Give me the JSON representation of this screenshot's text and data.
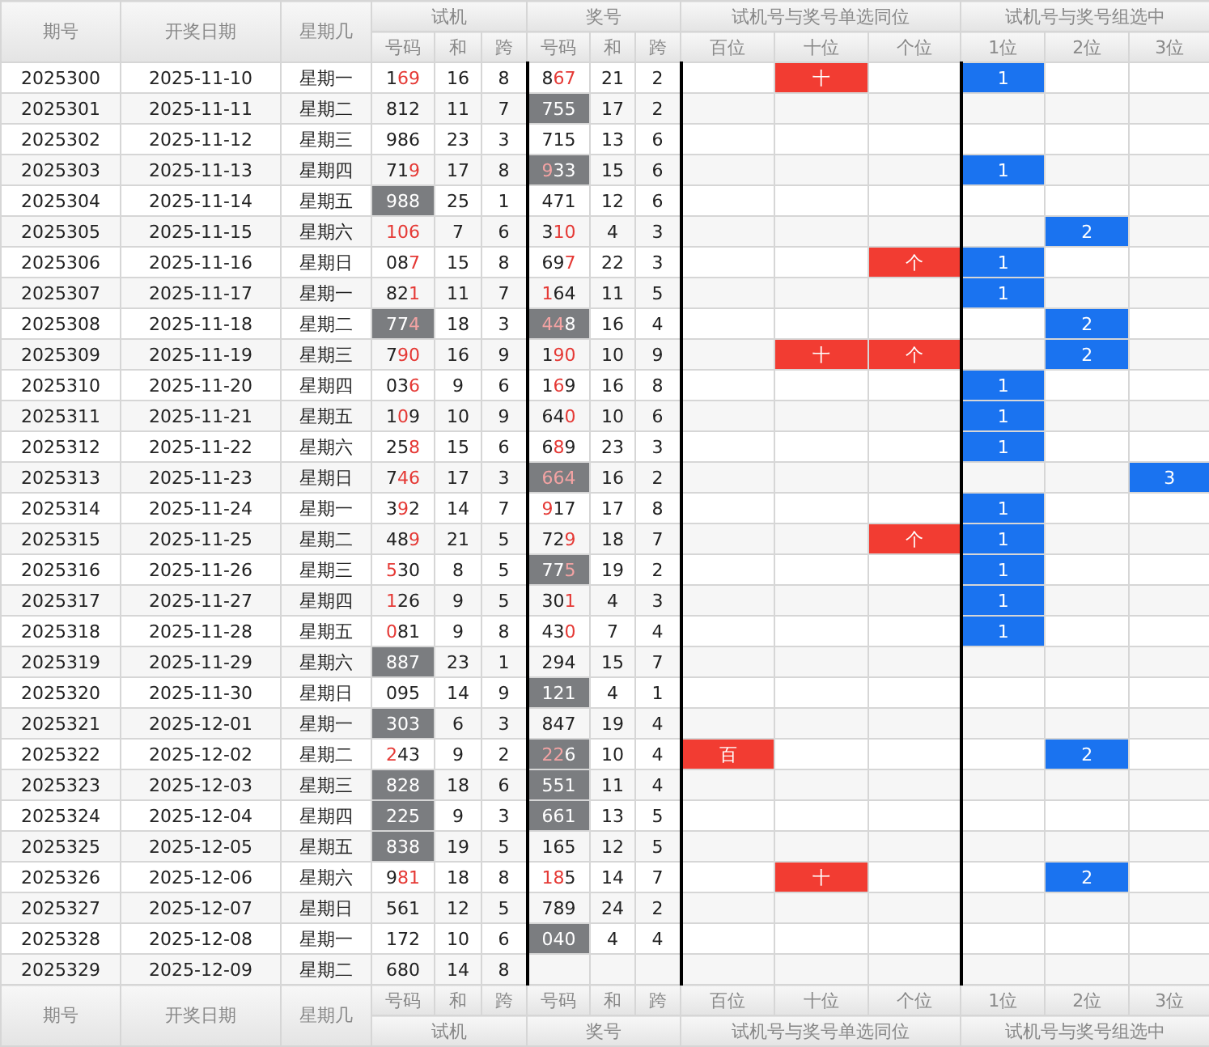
{
  "header": {
    "fixed": [
      "期号",
      "开奖日期",
      "星期几"
    ],
    "groups": [
      {
        "label": "试机",
        "subcolumns": [
          "号码",
          "和",
          "跨"
        ]
      },
      {
        "label": "奖号",
        "subcolumns": [
          "号码",
          "和",
          "跨"
        ]
      },
      {
        "label": "试机号与奖号单选同位",
        "subcolumns": [
          "百位",
          "十位",
          "个位"
        ]
      },
      {
        "label": "试机号与奖号组选中",
        "subcolumns": [
          "1位",
          "2位",
          "3位"
        ]
      }
    ]
  },
  "rows": [
    {
      "issue": "2025300",
      "date": "2025-11-10",
      "weekday": "星期一",
      "test": {
        "number": "169",
        "match": [
          false,
          true,
          true
        ],
        "pair": false,
        "sum": "16",
        "span": "8"
      },
      "draw": {
        "number": "867",
        "match": [
          false,
          true,
          true
        ],
        "pair": false,
        "sum": "21",
        "span": "2"
      },
      "single": {
        "tens": "十"
      },
      "group": {
        "pos1": "1"
      }
    },
    {
      "issue": "2025301",
      "date": "2025-11-11",
      "weekday": "星期二",
      "test": {
        "number": "812",
        "match": [
          false,
          false,
          false
        ],
        "pair": false,
        "sum": "11",
        "span": "7"
      },
      "draw": {
        "number": "755",
        "match": [
          false,
          false,
          false
        ],
        "pair": true,
        "sum": "17",
        "span": "2"
      },
      "single": {},
      "group": {}
    },
    {
      "issue": "2025302",
      "date": "2025-11-12",
      "weekday": "星期三",
      "test": {
        "number": "986",
        "match": [
          false,
          false,
          false
        ],
        "pair": false,
        "sum": "23",
        "span": "3"
      },
      "draw": {
        "number": "715",
        "match": [
          false,
          false,
          false
        ],
        "pair": false,
        "sum": "13",
        "span": "6"
      },
      "single": {},
      "group": {}
    },
    {
      "issue": "2025303",
      "date": "2025-11-13",
      "weekday": "星期四",
      "test": {
        "number": "719",
        "match": [
          false,
          false,
          true
        ],
        "pair": false,
        "sum": "17",
        "span": "8"
      },
      "draw": {
        "number": "933",
        "match": [
          true,
          false,
          false
        ],
        "pair": true,
        "sum": "15",
        "span": "6"
      },
      "single": {},
      "group": {
        "pos1": "1"
      }
    },
    {
      "issue": "2025304",
      "date": "2025-11-14",
      "weekday": "星期五",
      "test": {
        "number": "988",
        "match": [
          false,
          false,
          false
        ],
        "pair": true,
        "sum": "25",
        "span": "1"
      },
      "draw": {
        "number": "471",
        "match": [
          false,
          false,
          false
        ],
        "pair": false,
        "sum": "12",
        "span": "6"
      },
      "single": {},
      "group": {}
    },
    {
      "issue": "2025305",
      "date": "2025-11-15",
      "weekday": "星期六",
      "test": {
        "number": "106",
        "match": [
          true,
          true,
          true
        ],
        "pair": false,
        "sum": "7",
        "span": "6"
      },
      "draw": {
        "number": "310",
        "match": [
          false,
          true,
          true
        ],
        "pair": false,
        "sum": "4",
        "span": "3"
      },
      "single": {},
      "group": {
        "pos2": "2"
      }
    },
    {
      "issue": "2025306",
      "date": "2025-11-16",
      "weekday": "星期日",
      "test": {
        "number": "087",
        "match": [
          false,
          false,
          true
        ],
        "pair": false,
        "sum": "15",
        "span": "8"
      },
      "draw": {
        "number": "697",
        "match": [
          false,
          false,
          true
        ],
        "pair": false,
        "sum": "22",
        "span": "3"
      },
      "single": {
        "ones": "个"
      },
      "group": {
        "pos1": "1"
      }
    },
    {
      "issue": "2025307",
      "date": "2025-11-17",
      "weekday": "星期一",
      "test": {
        "number": "821",
        "match": [
          false,
          false,
          true
        ],
        "pair": false,
        "sum": "11",
        "span": "7"
      },
      "draw": {
        "number": "164",
        "match": [
          true,
          false,
          false
        ],
        "pair": false,
        "sum": "11",
        "span": "5"
      },
      "single": {},
      "group": {
        "pos1": "1"
      }
    },
    {
      "issue": "2025308",
      "date": "2025-11-18",
      "weekday": "星期二",
      "test": {
        "number": "774",
        "match": [
          false,
          false,
          true
        ],
        "pair": true,
        "sum": "18",
        "span": "3"
      },
      "draw": {
        "number": "448",
        "match": [
          true,
          true,
          false
        ],
        "pair": true,
        "sum": "16",
        "span": "4"
      },
      "single": {},
      "group": {
        "pos2": "2"
      }
    },
    {
      "issue": "2025309",
      "date": "2025-11-19",
      "weekday": "星期三",
      "test": {
        "number": "790",
        "match": [
          false,
          true,
          true
        ],
        "pair": false,
        "sum": "16",
        "span": "9"
      },
      "draw": {
        "number": "190",
        "match": [
          false,
          true,
          true
        ],
        "pair": false,
        "sum": "10",
        "span": "9"
      },
      "single": {
        "tens": "十",
        "ones": "个"
      },
      "group": {
        "pos2": "2"
      }
    },
    {
      "issue": "2025310",
      "date": "2025-11-20",
      "weekday": "星期四",
      "test": {
        "number": "036",
        "match": [
          false,
          false,
          true
        ],
        "pair": false,
        "sum": "9",
        "span": "6"
      },
      "draw": {
        "number": "169",
        "match": [
          false,
          true,
          false
        ],
        "pair": false,
        "sum": "16",
        "span": "8"
      },
      "single": {},
      "group": {
        "pos1": "1"
      }
    },
    {
      "issue": "2025311",
      "date": "2025-11-21",
      "weekday": "星期五",
      "test": {
        "number": "109",
        "match": [
          false,
          true,
          false
        ],
        "pair": false,
        "sum": "10",
        "span": "9"
      },
      "draw": {
        "number": "640",
        "match": [
          false,
          false,
          true
        ],
        "pair": false,
        "sum": "10",
        "span": "6"
      },
      "single": {},
      "group": {
        "pos1": "1"
      }
    },
    {
      "issue": "2025312",
      "date": "2025-11-22",
      "weekday": "星期六",
      "test": {
        "number": "258",
        "match": [
          false,
          false,
          true
        ],
        "pair": false,
        "sum": "15",
        "span": "6"
      },
      "draw": {
        "number": "689",
        "match": [
          false,
          true,
          false
        ],
        "pair": false,
        "sum": "23",
        "span": "3"
      },
      "single": {},
      "group": {
        "pos1": "1"
      }
    },
    {
      "issue": "2025313",
      "date": "2025-11-23",
      "weekday": "星期日",
      "test": {
        "number": "746",
        "match": [
          false,
          true,
          true
        ],
        "pair": false,
        "sum": "17",
        "span": "3"
      },
      "draw": {
        "number": "664",
        "match": [
          true,
          true,
          true
        ],
        "pair": true,
        "sum": "16",
        "span": "2"
      },
      "single": {},
      "group": {
        "pos3": "3"
      }
    },
    {
      "issue": "2025314",
      "date": "2025-11-24",
      "weekday": "星期一",
      "test": {
        "number": "392",
        "match": [
          false,
          true,
          false
        ],
        "pair": false,
        "sum": "14",
        "span": "7"
      },
      "draw": {
        "number": "917",
        "match": [
          true,
          false,
          false
        ],
        "pair": false,
        "sum": "17",
        "span": "8"
      },
      "single": {},
      "group": {
        "pos1": "1"
      }
    },
    {
      "issue": "2025315",
      "date": "2025-11-25",
      "weekday": "星期二",
      "test": {
        "number": "489",
        "match": [
          false,
          false,
          true
        ],
        "pair": false,
        "sum": "21",
        "span": "5"
      },
      "draw": {
        "number": "729",
        "match": [
          false,
          false,
          true
        ],
        "pair": false,
        "sum": "18",
        "span": "7"
      },
      "single": {
        "ones": "个"
      },
      "group": {
        "pos1": "1"
      }
    },
    {
      "issue": "2025316",
      "date": "2025-11-26",
      "weekday": "星期三",
      "test": {
        "number": "530",
        "match": [
          true,
          false,
          false
        ],
        "pair": false,
        "sum": "8",
        "span": "5"
      },
      "draw": {
        "number": "775",
        "match": [
          false,
          false,
          true
        ],
        "pair": true,
        "sum": "19",
        "span": "2"
      },
      "single": {},
      "group": {
        "pos1": "1"
      }
    },
    {
      "issue": "2025317",
      "date": "2025-11-27",
      "weekday": "星期四",
      "test": {
        "number": "126",
        "match": [
          true,
          false,
          false
        ],
        "pair": false,
        "sum": "9",
        "span": "5"
      },
      "draw": {
        "number": "301",
        "match": [
          false,
          false,
          true
        ],
        "pair": false,
        "sum": "4",
        "span": "3"
      },
      "single": {},
      "group": {
        "pos1": "1"
      }
    },
    {
      "issue": "2025318",
      "date": "2025-11-28",
      "weekday": "星期五",
      "test": {
        "number": "081",
        "match": [
          true,
          false,
          false
        ],
        "pair": false,
        "sum": "9",
        "span": "8"
      },
      "draw": {
        "number": "430",
        "match": [
          false,
          false,
          true
        ],
        "pair": false,
        "sum": "7",
        "span": "4"
      },
      "single": {},
      "group": {
        "pos1": "1"
      }
    },
    {
      "issue": "2025319",
      "date": "2025-11-29",
      "weekday": "星期六",
      "test": {
        "number": "887",
        "match": [
          false,
          false,
          false
        ],
        "pair": true,
        "sum": "23",
        "span": "1"
      },
      "draw": {
        "number": "294",
        "match": [
          false,
          false,
          false
        ],
        "pair": false,
        "sum": "15",
        "span": "7"
      },
      "single": {},
      "group": {}
    },
    {
      "issue": "2025320",
      "date": "2025-11-30",
      "weekday": "星期日",
      "test": {
        "number": "095",
        "match": [
          false,
          false,
          false
        ],
        "pair": false,
        "sum": "14",
        "span": "9"
      },
      "draw": {
        "number": "121",
        "match": [
          false,
          false,
          false
        ],
        "pair": true,
        "sum": "4",
        "span": "1"
      },
      "single": {},
      "group": {}
    },
    {
      "issue": "2025321",
      "date": "2025-12-01",
      "weekday": "星期一",
      "test": {
        "number": "303",
        "match": [
          false,
          false,
          false
        ],
        "pair": true,
        "sum": "6",
        "span": "3"
      },
      "draw": {
        "number": "847",
        "match": [
          false,
          false,
          false
        ],
        "pair": false,
        "sum": "19",
        "span": "4"
      },
      "single": {},
      "group": {}
    },
    {
      "issue": "2025322",
      "date": "2025-12-02",
      "weekday": "星期二",
      "test": {
        "number": "243",
        "match": [
          true,
          false,
          false
        ],
        "pair": false,
        "sum": "9",
        "span": "2"
      },
      "draw": {
        "number": "226",
        "match": [
          true,
          true,
          false
        ],
        "pair": true,
        "sum": "10",
        "span": "4"
      },
      "single": {
        "hundreds": "百"
      },
      "group": {
        "pos2": "2"
      }
    },
    {
      "issue": "2025323",
      "date": "2025-12-03",
      "weekday": "星期三",
      "test": {
        "number": "828",
        "match": [
          false,
          false,
          false
        ],
        "pair": true,
        "sum": "18",
        "span": "6"
      },
      "draw": {
        "number": "551",
        "match": [
          false,
          false,
          false
        ],
        "pair": true,
        "sum": "11",
        "span": "4"
      },
      "single": {},
      "group": {}
    },
    {
      "issue": "2025324",
      "date": "2025-12-04",
      "weekday": "星期四",
      "test": {
        "number": "225",
        "match": [
          false,
          false,
          false
        ],
        "pair": true,
        "sum": "9",
        "span": "3"
      },
      "draw": {
        "number": "661",
        "match": [
          false,
          false,
          false
        ],
        "pair": true,
        "sum": "13",
        "span": "5"
      },
      "single": {},
      "group": {}
    },
    {
      "issue": "2025325",
      "date": "2025-12-05",
      "weekday": "星期五",
      "test": {
        "number": "838",
        "match": [
          false,
          false,
          false
        ],
        "pair": true,
        "sum": "19",
        "span": "5"
      },
      "draw": {
        "number": "165",
        "match": [
          false,
          false,
          false
        ],
        "pair": false,
        "sum": "12",
        "span": "5"
      },
      "single": {},
      "group": {}
    },
    {
      "issue": "2025326",
      "date": "2025-12-06",
      "weekday": "星期六",
      "test": {
        "number": "981",
        "match": [
          false,
          true,
          true
        ],
        "pair": false,
        "sum": "18",
        "span": "8"
      },
      "draw": {
        "number": "185",
        "match": [
          true,
          true,
          false
        ],
        "pair": false,
        "sum": "14",
        "span": "7"
      },
      "single": {
        "tens": "十"
      },
      "group": {
        "pos2": "2"
      }
    },
    {
      "issue": "2025327",
      "date": "2025-12-07",
      "weekday": "星期日",
      "test": {
        "number": "561",
        "match": [
          false,
          false,
          false
        ],
        "pair": false,
        "sum": "12",
        "span": "5"
      },
      "draw": {
        "number": "789",
        "match": [
          false,
          false,
          false
        ],
        "pair": false,
        "sum": "24",
        "span": "2"
      },
      "single": {},
      "group": {}
    },
    {
      "issue": "2025328",
      "date": "2025-12-08",
      "weekday": "星期一",
      "test": {
        "number": "172",
        "match": [
          false,
          false,
          false
        ],
        "pair": false,
        "sum": "10",
        "span": "6"
      },
      "draw": {
        "number": "040",
        "match": [
          false,
          false,
          false
        ],
        "pair": true,
        "sum": "4",
        "span": "4"
      },
      "single": {},
      "group": {}
    },
    {
      "issue": "2025329",
      "date": "2025-12-09",
      "weekday": "星期二",
      "test": {
        "number": "680",
        "match": [
          false,
          false,
          false
        ],
        "pair": false,
        "sum": "14",
        "span": "8"
      },
      "single": {},
      "group": {}
    }
  ],
  "footer": {
    "fixed": [
      "期号",
      "开奖日期",
      "星期几"
    ],
    "groups": [
      {
        "label": "试机",
        "subcolumns": [
          "号码",
          "和",
          "跨"
        ]
      },
      {
        "label": "奖号",
        "subcolumns": [
          "号码",
          "和",
          "跨"
        ]
      },
      {
        "label": "试机号与奖号单选同位",
        "subcolumns": [
          "百位",
          "十位",
          "个位"
        ]
      },
      {
        "label": "试机号与奖号组选中",
        "subcolumns": [
          "1位",
          "2位",
          "3位"
        ]
      }
    ]
  }
}
